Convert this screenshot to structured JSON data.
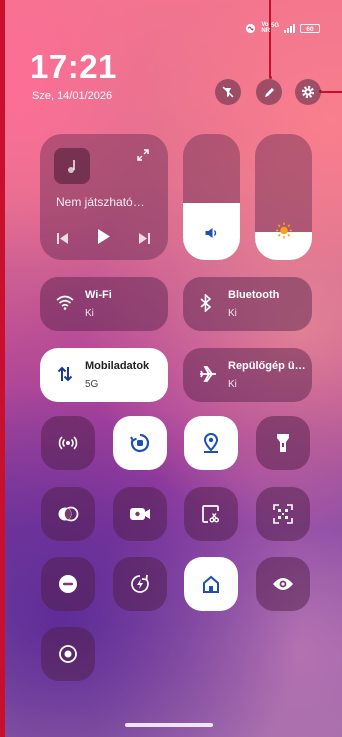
{
  "status_bar": {
    "network_line1": "Vo",
    "network_line2": "NR",
    "network_type": "5G",
    "battery": "60"
  },
  "clock": {
    "time": "17:21",
    "date": "Sze, 14/01/2026"
  },
  "media": {
    "now_playing": "Nem játszható…"
  },
  "sliders": {
    "volume_level": 0.45,
    "brightness_level": 0.22
  },
  "tiles": {
    "wifi": {
      "name": "Wi-Fi",
      "status": "Ki"
    },
    "bluetooth": {
      "name": "Bluetooth",
      "status": "Ki"
    },
    "mobile_data": {
      "name": "Mobiladatok",
      "status": "5G"
    },
    "airplane": {
      "name": "Repülőgép ü…",
      "status": "Ki"
    }
  },
  "quick_toggles": [
    "hotspot-icon",
    "auto-rotate-icon",
    "location-icon",
    "flashlight-icon",
    "color-inversion-icon",
    "screen-record-icon",
    "screenshot-icon",
    "qr-scanner-icon",
    "do-not-disturb-icon",
    "battery-saver-icon",
    "home-icon",
    "eye-comfort-icon",
    "dark-mode-icon"
  ],
  "colors": {
    "accent_dark": "#3a1a44",
    "brightness_sun": "#f6a21b",
    "volume_icon": "#1f4fb5"
  }
}
